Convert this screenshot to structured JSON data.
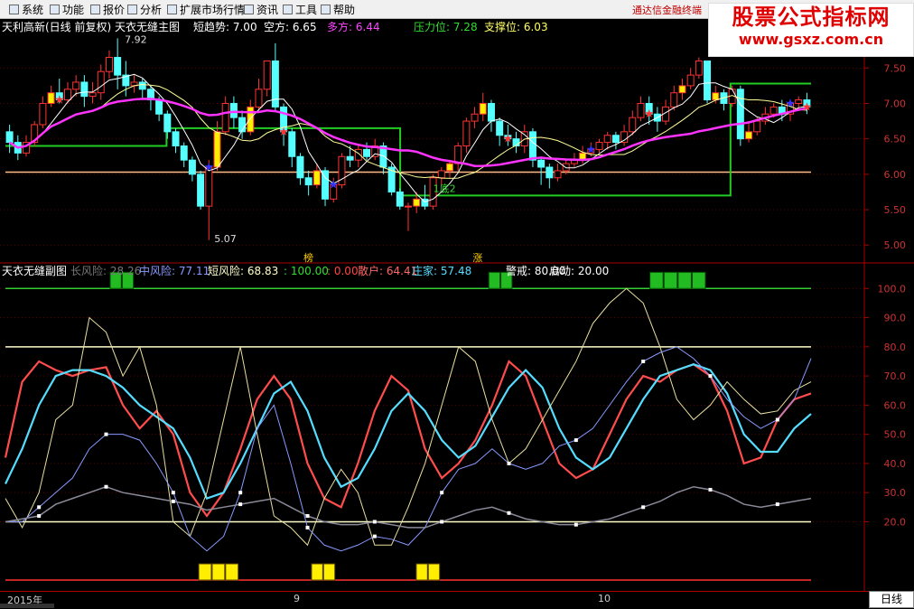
{
  "menu": [
    {
      "label": "系统"
    },
    {
      "label": "功能"
    },
    {
      "label": "报价"
    },
    {
      "label": "分析"
    },
    {
      "label": "扩展市场行情"
    },
    {
      "label": "资讯"
    },
    {
      "label": "工具"
    },
    {
      "label": "帮助"
    }
  ],
  "broker": "通达信金融终端",
  "watermark": {
    "title": "股票公式指标网",
    "url": "www.gsxz.com.cn"
  },
  "main_legend": {
    "title": "天利高新(日线 前复权) 天衣无缝主图",
    "items": [
      {
        "text": "短趋势: 7.00",
        "color": "#ffffff"
      },
      {
        "text": "空方: 6.65",
        "color": "#ffffff"
      },
      {
        "text": "多方: 6.44",
        "color": "#ff44ff"
      },
      {
        "text": "压力位: 7.28",
        "color": "#33dd33"
      },
      {
        "text": "支撑位: 6.03",
        "color": "#ffff66"
      }
    ]
  },
  "sub_legend": {
    "title": "天衣无缝副图",
    "items": [
      {
        "text": "长风险: 28.26",
        "color": "#777777"
      },
      {
        "text": "中风险: 77.11",
        "color": "#8899ff"
      },
      {
        "text": "短风险: 68.83",
        "color": "#ffffcc"
      },
      {
        "text": ": 100.00",
        "color": "#33dd33"
      },
      {
        "text": ": 0.00",
        "color": "#ff4444"
      },
      {
        "text": "散户: 64.41",
        "color": "#ff6666"
      },
      {
        "text": "庄家: 57.48",
        "color": "#55ddff"
      },
      {
        "text": "警戒: 80.00",
        "color": "#ffffff"
      },
      {
        "text": "启动: 20.00",
        "color": "#ffffff"
      }
    ]
  },
  "annotations": {
    "high": "7.92",
    "low": "5.07",
    "bottom": "1底2",
    "bang": "榜",
    "zhang": "涨"
  },
  "dates": [
    {
      "label": "2015年",
      "x": 8
    },
    {
      "label": "9",
      "x": 325
    },
    {
      "label": "10",
      "x": 662
    }
  ],
  "period": "日线",
  "chart_data": [
    {
      "type": "candlestick",
      "y_ticks": [
        5.0,
        5.5,
        6.0,
        6.5,
        7.0,
        7.5
      ],
      "ylim": [
        4.85,
        7.95
      ],
      "candles": [
        [
          6.6,
          6.45,
          6.7,
          6.3
        ],
        [
          6.45,
          6.3,
          6.55,
          6.2
        ],
        [
          6.3,
          6.45,
          6.55,
          6.25
        ],
        [
          6.45,
          6.7,
          6.75,
          6.4
        ],
        [
          6.7,
          7.0,
          7.1,
          6.65
        ],
        [
          7.0,
          7.15,
          7.25,
          6.95
        ],
        [
          7.15,
          7.05,
          7.35,
          7.0
        ],
        [
          7.05,
          7.2,
          7.3,
          7.0
        ],
        [
          7.2,
          7.3,
          7.4,
          7.1
        ],
        [
          7.3,
          7.1,
          7.4,
          6.95
        ],
        [
          7.1,
          7.15,
          7.3,
          7.0
        ],
        [
          7.15,
          7.45,
          7.55,
          7.05
        ],
        [
          7.45,
          7.65,
          7.75,
          7.35
        ],
        [
          7.65,
          7.4,
          7.92,
          7.2
        ],
        [
          7.4,
          7.25,
          7.6,
          7.1
        ],
        [
          7.25,
          7.3,
          7.4,
          7.15
        ],
        [
          7.3,
          7.2,
          7.35,
          7.05
        ],
        [
          7.2,
          7.05,
          7.25,
          6.9
        ],
        [
          7.05,
          6.85,
          7.1,
          6.75
        ],
        [
          6.85,
          6.6,
          6.9,
          6.5
        ],
        [
          6.6,
          6.4,
          6.65,
          6.3
        ],
        [
          6.4,
          6.2,
          6.45,
          6.1
        ],
        [
          6.2,
          6.0,
          6.25,
          5.9
        ],
        [
          6.0,
          5.55,
          6.05,
          5.5
        ],
        [
          5.55,
          6.1,
          6.2,
          5.07
        ],
        [
          6.1,
          6.6,
          6.75,
          6.05
        ],
        [
          6.6,
          7.0,
          7.1,
          6.55
        ],
        [
          7.0,
          6.8,
          7.1,
          6.65
        ],
        [
          6.8,
          6.6,
          6.9,
          6.5
        ],
        [
          6.6,
          6.95,
          7.05,
          6.55
        ],
        [
          6.95,
          7.2,
          7.35,
          6.9
        ],
        [
          7.2,
          7.6,
          7.55,
          7.1
        ],
        [
          7.6,
          6.95,
          7.85,
          6.9
        ],
        [
          6.95,
          6.6,
          7.0,
          6.4
        ],
        [
          6.6,
          6.25,
          6.65,
          6.1
        ],
        [
          6.25,
          5.95,
          6.3,
          5.85
        ],
        [
          5.95,
          5.85,
          6.05,
          5.7
        ],
        [
          5.85,
          6.05,
          6.15,
          5.8
        ],
        [
          6.05,
          5.65,
          6.1,
          5.55
        ],
        [
          5.65,
          5.85,
          5.95,
          5.6
        ],
        [
          5.85,
          6.25,
          6.3,
          5.8
        ],
        [
          6.25,
          6.2,
          6.4,
          6.1
        ],
        [
          6.2,
          6.35,
          6.4,
          6.1
        ],
        [
          6.35,
          6.25,
          6.45,
          6.2
        ],
        [
          6.25,
          6.4,
          6.5,
          6.2
        ],
        [
          6.4,
          6.1,
          6.45,
          6.0
        ],
        [
          6.1,
          5.75,
          6.15,
          5.7
        ],
        [
          5.75,
          5.55,
          5.8,
          5.5
        ],
        [
          5.55,
          5.55,
          5.6,
          5.2
        ],
        [
          5.55,
          5.65,
          5.75,
          5.45
        ],
        [
          5.65,
          5.55,
          5.85,
          5.5
        ],
        [
          5.55,
          5.95,
          6.0,
          5.5
        ],
        [
          5.95,
          6.05,
          6.1,
          5.85
        ],
        [
          6.05,
          6.15,
          6.2,
          5.95
        ],
        [
          6.15,
          6.4,
          6.45,
          6.05
        ],
        [
          6.4,
          6.75,
          6.8,
          6.3
        ],
        [
          6.75,
          6.85,
          6.95,
          6.65
        ],
        [
          6.85,
          7.0,
          7.15,
          6.75
        ],
        [
          7.0,
          6.75,
          7.05,
          6.6
        ],
        [
          6.75,
          6.55,
          6.8,
          6.4
        ],
        [
          6.55,
          6.5,
          6.7,
          6.4
        ],
        [
          6.5,
          6.4,
          6.6,
          6.3
        ],
        [
          6.4,
          6.6,
          6.7,
          6.3
        ],
        [
          6.6,
          6.2,
          6.65,
          6.1
        ],
        [
          6.2,
          6.1,
          6.25,
          5.85
        ],
        [
          6.1,
          5.95,
          6.15,
          5.8
        ],
        [
          5.95,
          6.05,
          6.15,
          5.9
        ],
        [
          6.05,
          6.15,
          6.2,
          6.0
        ],
        [
          6.15,
          6.2,
          6.3,
          6.1
        ],
        [
          6.2,
          6.3,
          6.4,
          6.15
        ],
        [
          6.3,
          6.35,
          6.45,
          6.25
        ],
        [
          6.35,
          6.45,
          6.5,
          6.3
        ],
        [
          6.45,
          6.55,
          6.6,
          6.35
        ],
        [
          6.55,
          6.45,
          6.6,
          6.35
        ],
        [
          6.45,
          6.6,
          6.7,
          6.4
        ],
        [
          6.6,
          6.8,
          6.9,
          6.55
        ],
        [
          6.8,
          7.0,
          7.1,
          6.75
        ],
        [
          7.0,
          6.85,
          7.1,
          6.7
        ],
        [
          6.85,
          6.75,
          6.95,
          6.6
        ],
        [
          6.75,
          6.95,
          7.05,
          6.7
        ],
        [
          6.95,
          7.15,
          7.25,
          6.9
        ],
        [
          7.15,
          7.25,
          7.35,
          7.05
        ],
        [
          7.25,
          7.4,
          7.5,
          7.2
        ],
        [
          7.4,
          7.6,
          7.65,
          7.35
        ],
        [
          7.6,
          7.05,
          7.6,
          7.0
        ],
        [
          7.05,
          7.15,
          7.25,
          7.0
        ],
        [
          7.15,
          7.0,
          7.2,
          6.9
        ],
        [
          7.0,
          7.2,
          7.25,
          6.95
        ],
        [
          7.2,
          6.5,
          7.25,
          6.4
        ],
        [
          6.5,
          6.6,
          6.75,
          6.45
        ],
        [
          6.6,
          6.75,
          6.8,
          6.55
        ],
        [
          6.75,
          6.85,
          6.95,
          6.7
        ],
        [
          6.85,
          6.95,
          7.0,
          6.8
        ],
        [
          6.95,
          6.85,
          7.05,
          6.75
        ],
        [
          6.85,
          7.0,
          7.05,
          6.75
        ],
        [
          7.0,
          7.05,
          7.1,
          6.9
        ],
        [
          7.05,
          6.95,
          7.15,
          6.85
        ]
      ],
      "pressure_levels": [
        {
          "from": 0.0,
          "to": 0.2,
          "value": 6.4
        },
        {
          "from": 0.2,
          "to": 0.49,
          "value": 6.65
        },
        {
          "from": 0.49,
          "to": 0.9,
          "value": 5.7
        },
        {
          "from": 0.9,
          "to": 1.0,
          "value": 7.28
        }
      ],
      "support_level": 6.03
    },
    {
      "type": "line",
      "y_ticks": [
        20,
        30,
        40,
        50,
        60,
        70,
        80,
        90,
        100
      ],
      "ylim": [
        0,
        110
      ],
      "reference_lines": [
        {
          "value": 100,
          "color": "#33cc33"
        },
        {
          "value": 80,
          "color": "#ffffcc"
        },
        {
          "value": 20,
          "color": "#ffffcc"
        },
        {
          "value": 0,
          "color": "#ff3333"
        }
      ],
      "series": [
        {
          "name": "散户",
          "color": "#ff4d4d",
          "width": 2.2,
          "values": [
            42,
            68,
            75,
            72,
            70,
            72,
            73,
            60,
            52,
            58,
            50,
            30,
            22,
            30,
            45,
            62,
            70,
            62,
            40,
            28,
            25,
            40,
            58,
            70,
            65,
            45,
            35,
            40,
            48,
            60,
            75,
            70,
            55,
            40,
            35,
            38,
            50,
            62,
            70,
            68,
            72,
            74,
            70,
            58,
            40,
            42,
            55,
            62,
            64
          ]
        },
        {
          "name": "庄家",
          "color": "#55ddff",
          "width": 2.2,
          "values": [
            33,
            45,
            60,
            70,
            72,
            72,
            70,
            66,
            60,
            56,
            52,
            42,
            28,
            30,
            40,
            52,
            64,
            68,
            58,
            42,
            32,
            35,
            45,
            58,
            64,
            58,
            48,
            42,
            46,
            56,
            66,
            72,
            66,
            52,
            42,
            38,
            42,
            52,
            62,
            70,
            72,
            74,
            72,
            64,
            50,
            44,
            44,
            52,
            57
          ]
        },
        {
          "name": "短风险",
          "color": "#e8e0a0",
          "width": 1,
          "values": [
            28,
            18,
            30,
            55,
            60,
            90,
            85,
            70,
            80,
            60,
            20,
            15,
            30,
            55,
            80,
            50,
            22,
            18,
            12,
            28,
            38,
            30,
            12,
            12,
            25,
            40,
            60,
            80,
            75,
            55,
            40,
            45,
            55,
            65,
            75,
            88,
            95,
            100,
            95,
            80,
            62,
            55,
            60,
            68,
            62,
            57,
            58,
            65,
            68
          ]
        },
        {
          "name": "中风险",
          "color": "#8899ff",
          "width": 1,
          "values": [
            20,
            20,
            25,
            30,
            35,
            45,
            50,
            50,
            48,
            40,
            30,
            15,
            10,
            15,
            30,
            52,
            60,
            40,
            18,
            12,
            10,
            12,
            15,
            14,
            12,
            18,
            30,
            38,
            40,
            45,
            40,
            38,
            40,
            46,
            48,
            52,
            60,
            68,
            75,
            78,
            80,
            76,
            70,
            62,
            56,
            52,
            55,
            62,
            76
          ]
        },
        {
          "name": "长风险",
          "color": "#8a8a9a",
          "width": 1.5,
          "values": [
            20,
            21,
            22,
            26,
            28,
            30,
            32,
            30,
            29,
            28,
            27,
            26,
            24,
            25,
            26,
            27,
            28,
            25,
            22,
            20,
            19,
            19,
            20,
            19,
            18,
            18,
            20,
            22,
            24,
            25,
            23,
            21,
            20,
            19,
            19,
            20,
            21,
            23,
            25,
            27,
            30,
            32,
            31,
            29,
            26,
            25,
            26,
            27,
            28
          ]
        }
      ],
      "top_blocks": [
        {
          "from": 0.13,
          "to": 0.16
        },
        {
          "from": 0.6,
          "to": 0.63
        },
        {
          "from": 0.8,
          "to": 0.87
        }
      ],
      "bottom_blocks": [
        {
          "from": 0.24,
          "to": 0.29
        },
        {
          "from": 0.38,
          "to": 0.41
        },
        {
          "from": 0.51,
          "to": 0.54
        }
      ]
    }
  ]
}
